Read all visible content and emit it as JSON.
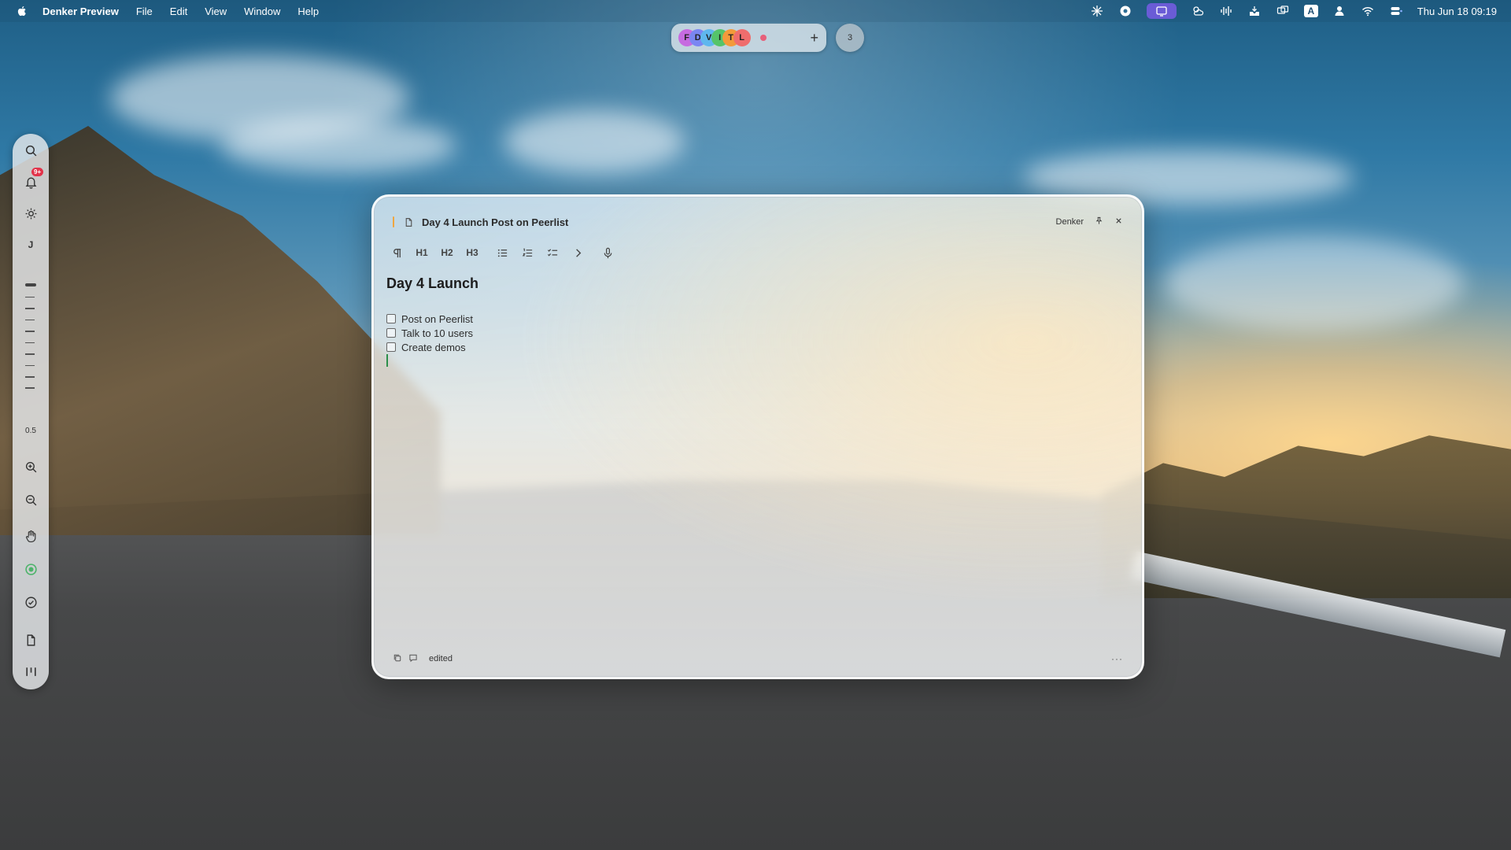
{
  "menubar": {
    "app_name": "Denker Preview",
    "menus": [
      "File",
      "Edit",
      "View",
      "Window",
      "Help"
    ],
    "keyboard_letter": "A",
    "clock": "Thu Jun 18  09:19"
  },
  "spaces": {
    "minus": "-",
    "letters": [
      "F",
      "D",
      "V",
      "I",
      "T",
      "L"
    ],
    "letter_colors": [
      "#c66be0",
      "#7a86f2",
      "#5fb7ee",
      "#55c46a",
      "#f39a3a",
      "#ef6d6d"
    ],
    "plus": "+",
    "count": "3"
  },
  "dock": {
    "notification_badge": "9+",
    "letter_item": "J",
    "zoom_value": "0.5"
  },
  "note": {
    "title": "Day 4 Launch Post on Peerlist",
    "workspace": "Denker",
    "toolbar": {
      "h1": "H1",
      "h2": "H2",
      "h3": "H3"
    },
    "heading": "Day 4 Launch",
    "tasks": [
      {
        "label": "Post on Peerlist",
        "checked": false
      },
      {
        "label": "Talk to 10 users",
        "checked": false
      },
      {
        "label": "Create demos",
        "checked": false
      }
    ],
    "status": "edited",
    "more": "···"
  },
  "colors": {
    "accent": "#6a5cd6",
    "badge": "#e2334a",
    "title_accent": "#f0a640",
    "caret": "#2c8f4a"
  }
}
